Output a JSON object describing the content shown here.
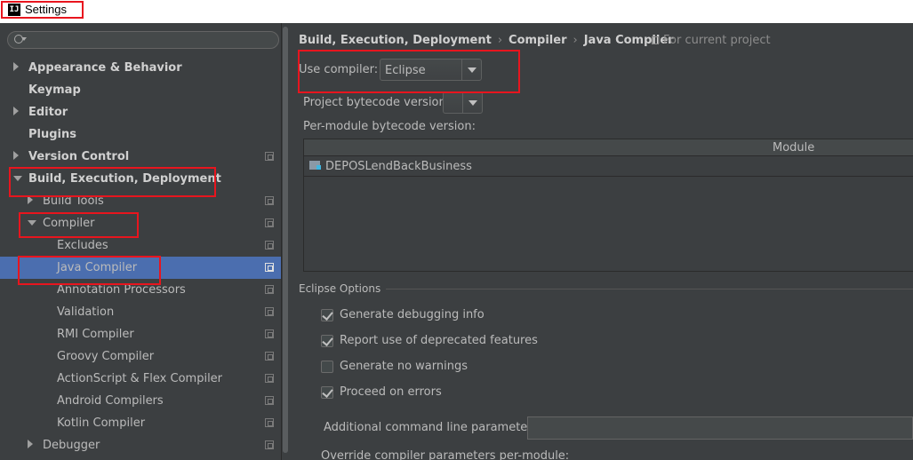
{
  "window": {
    "title": "Settings",
    "icon": "intellij-icon"
  },
  "search": {
    "placeholder": ""
  },
  "tree": [
    {
      "label": "Appearance & Behavior",
      "bold": true,
      "arrow": "right",
      "level": 0
    },
    {
      "label": "Keymap",
      "bold": true,
      "arrow": "none",
      "level": 0
    },
    {
      "label": "Editor",
      "bold": true,
      "arrow": "right",
      "level": 0
    },
    {
      "label": "Plugins",
      "bold": true,
      "arrow": "none",
      "level": 0
    },
    {
      "label": "Version Control",
      "bold": true,
      "arrow": "right",
      "level": 0,
      "copy": true
    },
    {
      "label": "Build, Execution, Deployment",
      "bold": true,
      "arrow": "down",
      "level": 0
    },
    {
      "label": "Build Tools",
      "bold": false,
      "arrow": "right",
      "level": 1,
      "copy": true
    },
    {
      "label": "Compiler",
      "bold": false,
      "arrow": "down",
      "level": 1,
      "copy": true
    },
    {
      "label": "Excludes",
      "bold": false,
      "arrow": "none",
      "level": 2,
      "copy": true
    },
    {
      "label": "Java Compiler",
      "bold": false,
      "arrow": "none",
      "level": 2,
      "copy": true,
      "selected": true
    },
    {
      "label": "Annotation Processors",
      "bold": false,
      "arrow": "none",
      "level": 2,
      "copy": true
    },
    {
      "label": "Validation",
      "bold": false,
      "arrow": "none",
      "level": 2,
      "copy": true
    },
    {
      "label": "RMI Compiler",
      "bold": false,
      "arrow": "none",
      "level": 2,
      "copy": true
    },
    {
      "label": "Groovy Compiler",
      "bold": false,
      "arrow": "none",
      "level": 2,
      "copy": true
    },
    {
      "label": "ActionScript & Flex Compiler",
      "bold": false,
      "arrow": "none",
      "level": 2,
      "copy": true
    },
    {
      "label": "Android Compilers",
      "bold": false,
      "arrow": "none",
      "level": 2,
      "copy": true
    },
    {
      "label": "Kotlin Compiler",
      "bold": false,
      "arrow": "none",
      "level": 2,
      "copy": true
    },
    {
      "label": "Debugger",
      "bold": false,
      "arrow": "right",
      "level": 1,
      "copy": true
    }
  ],
  "breadcrumb": [
    "Build, Execution, Deployment",
    "Compiler",
    "Java Compiler"
  ],
  "scope": "For current project",
  "use_compiler": {
    "label": "Use compiler:",
    "value": "Eclipse"
  },
  "bytecode": {
    "label": "Project bytecode version:",
    "value": ""
  },
  "per_module": {
    "label": "Per-module bytecode version:",
    "column": "Module",
    "rows": [
      "DEPOSLendBackBusiness"
    ]
  },
  "eclipse_options": {
    "title": "Eclipse Options",
    "checkboxes": [
      {
        "label": "Generate debugging info",
        "checked": true
      },
      {
        "label": "Report use of deprecated features",
        "checked": true
      },
      {
        "label": "Generate no warnings",
        "checked": false
      },
      {
        "label": "Proceed on errors",
        "checked": true
      }
    ],
    "additional_label": "Additional command line parameters:",
    "additional_value": "",
    "override_label": "Override compiler parameters per-module:"
  },
  "colors": {
    "highlight": "#e8151e",
    "selection": "#4b6eaf",
    "background": "#3c3f41"
  }
}
